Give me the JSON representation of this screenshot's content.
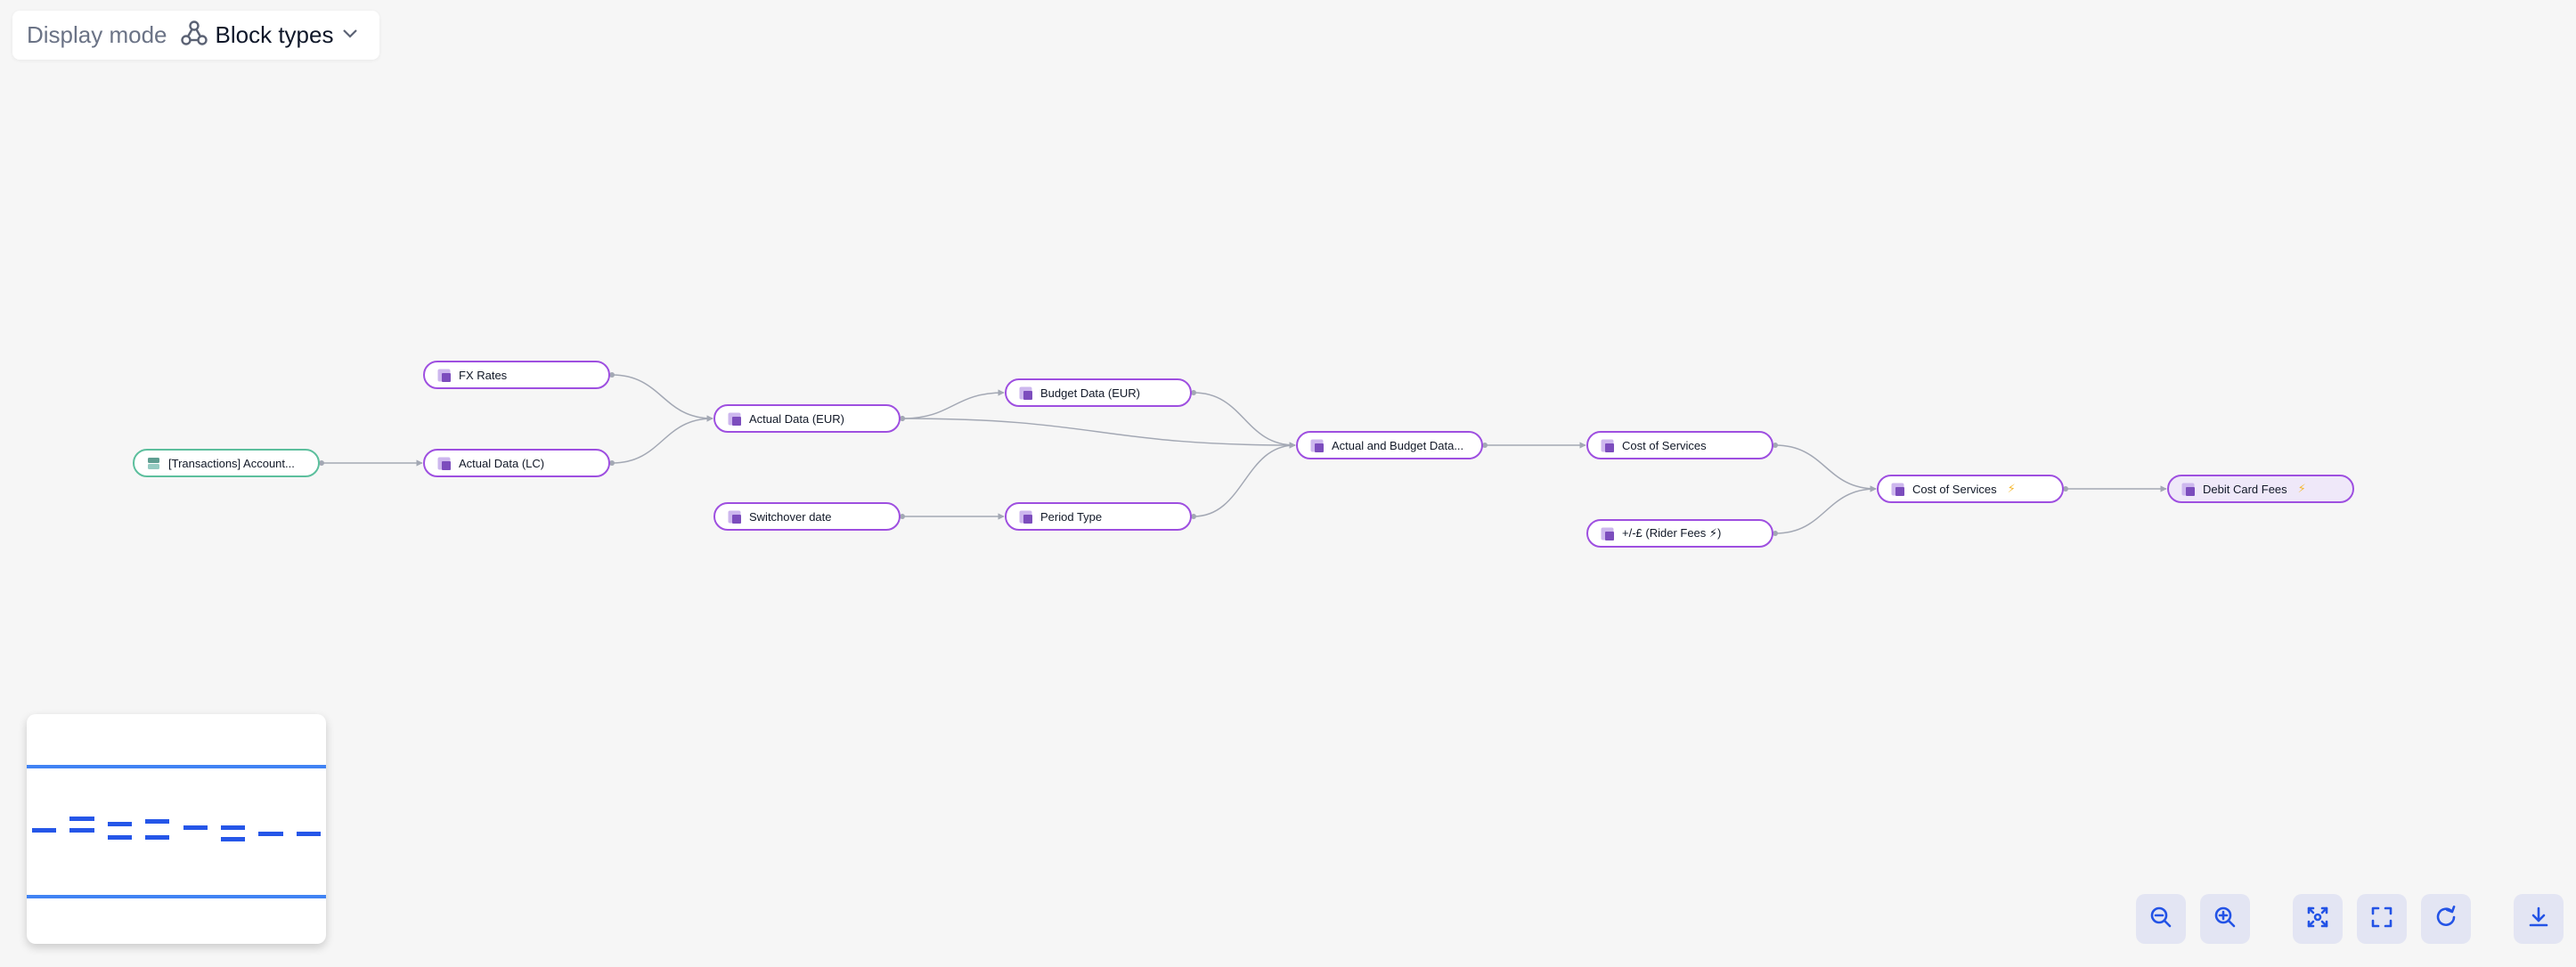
{
  "display_mode": {
    "label": "Display mode",
    "value": "Block types",
    "icon": "graph-nodes-icon",
    "dropdown_icon": "chevron-down-icon"
  },
  "colors": {
    "block_border": "#9e4fe0",
    "table_border": "#5cbf9d",
    "edge": "#a3a8b4",
    "selected_bg": "#efe8f9",
    "control_bg": "#e3e5f3",
    "control_icon": "#2353e6",
    "minimap_node": "#2556e8",
    "minimap_viewport": "#4183f4"
  },
  "nodes": [
    {
      "id": "transactions",
      "label": "[Transactions] Account...",
      "type": "table",
      "flash": false,
      "selected": false
    },
    {
      "id": "fx-rates",
      "label": "FX Rates",
      "type": "block",
      "flash": false,
      "selected": false
    },
    {
      "id": "actual-lc",
      "label": "Actual Data (LC)",
      "type": "block",
      "flash": false,
      "selected": false
    },
    {
      "id": "actual-eur",
      "label": "Actual Data (EUR)",
      "type": "block",
      "flash": false,
      "selected": false
    },
    {
      "id": "switchover",
      "label": "Switchover date",
      "type": "block",
      "flash": false,
      "selected": false
    },
    {
      "id": "budget-eur",
      "label": "Budget Data (EUR)",
      "type": "block",
      "flash": false,
      "selected": false
    },
    {
      "id": "period-type",
      "label": "Period Type",
      "type": "block",
      "flash": false,
      "selected": false
    },
    {
      "id": "actual-budget",
      "label": "Actual and Budget Data...",
      "type": "block",
      "flash": false,
      "selected": false
    },
    {
      "id": "cost-services",
      "label": "Cost of Services",
      "type": "block",
      "flash": false,
      "selected": false
    },
    {
      "id": "rider-fees",
      "label": "+/-£ (Rider Fees ⚡)",
      "type": "block",
      "flash": false,
      "selected": false
    },
    {
      "id": "cost-services-2",
      "label": "Cost of Services",
      "type": "block",
      "flash": true,
      "selected": false
    },
    {
      "id": "debit-card-fees",
      "label": "Debit Card Fees",
      "type": "block",
      "flash": true,
      "selected": true
    }
  ],
  "edges": [
    {
      "from": "transactions",
      "to": "actual-lc"
    },
    {
      "from": "fx-rates",
      "to": "actual-eur"
    },
    {
      "from": "actual-lc",
      "to": "actual-eur"
    },
    {
      "from": "actual-eur",
      "to": "budget-eur"
    },
    {
      "from": "actual-eur",
      "to": "actual-budget"
    },
    {
      "from": "budget-eur",
      "to": "actual-budget"
    },
    {
      "from": "switchover",
      "to": "period-type"
    },
    {
      "from": "period-type",
      "to": "actual-budget"
    },
    {
      "from": "actual-budget",
      "to": "cost-services"
    },
    {
      "from": "cost-services",
      "to": "cost-services-2"
    },
    {
      "from": "rider-fees",
      "to": "cost-services-2"
    },
    {
      "from": "cost-services-2",
      "to": "debit-card-fees"
    }
  ],
  "flash_glyph": "⚡",
  "controls": [
    {
      "id": "zoom-out",
      "label": "Zoom out",
      "icon": "zoom-out-icon"
    },
    {
      "id": "zoom-in",
      "label": "Zoom in",
      "icon": "zoom-in-icon"
    },
    {
      "id": "fit-view",
      "label": "Fit view",
      "icon": "focus-icon"
    },
    {
      "id": "fullscreen",
      "label": "Fullscreen",
      "icon": "fullscreen-icon"
    },
    {
      "id": "refresh",
      "label": "Reset",
      "icon": "refresh-icon"
    },
    {
      "id": "download",
      "label": "Download",
      "icon": "download-icon"
    }
  ]
}
